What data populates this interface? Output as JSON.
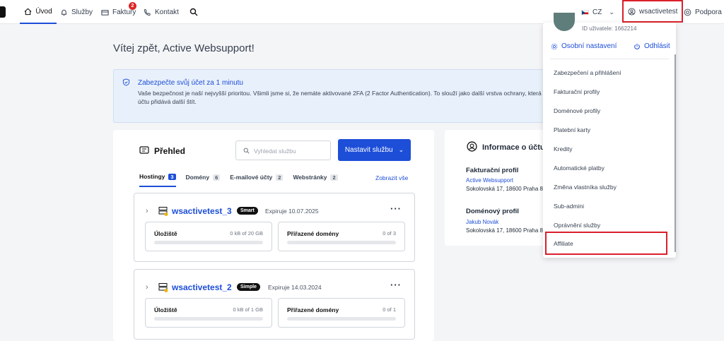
{
  "nav": {
    "home": "Úvod",
    "services": "Služby",
    "invoices": "Faktury",
    "invoices_badge": "2",
    "contact": "Kontakt",
    "lang": "CZ",
    "user": "wsactivetest",
    "support": "Podpora"
  },
  "greeting": "Vítej zpět, Active Websupport!",
  "alert": {
    "title": "Zabezpečte svůj účet za 1 minutu",
    "line1": "Vaše bezpečnost je naší nejvyšší prioritou. Všimli jsme si, že nemáte aktivované 2FA (2 Factor Authentication). To slouží jako další vrstva ochrany, která k vašemu",
    "line2": "účtu přidává další štít."
  },
  "overview": {
    "title": "Přehled",
    "search_placeholder": "Vyhledat službu",
    "setup_button": "Nastavit službu",
    "tabs": [
      {
        "label": "Hostingy",
        "count": "3"
      },
      {
        "label": "Domény",
        "count": "6"
      },
      {
        "label": "E-mailové účty",
        "count": "2"
      },
      {
        "label": "Webstránky",
        "count": "2"
      }
    ],
    "show_all": "Zobrazit vše",
    "services": [
      {
        "name": "wsactivetest_3",
        "plan": "Smart",
        "expiry": "Expiruje 10.07.2025",
        "storage_label": "Úložiště",
        "storage_value": "0 kB of 20 GB",
        "domains_label": "Přiřazené domény",
        "domains_value": "0 of 3"
      },
      {
        "name": "wsactivetest_2",
        "plan": "Simple",
        "expiry": "Expiruje 14.03.2024",
        "storage_label": "Úložiště",
        "storage_value": "0 kB of 1 GB",
        "domains_label": "Přiřazené domény",
        "domains_value": "0 of 1"
      }
    ]
  },
  "info": {
    "title": "Informace o účtu",
    "billing_title": "Fakturační profil",
    "billing_name": "Active Websupport",
    "billing_address": "Sokolovská 17, 18600 Praha 8",
    "domain_title": "Doménový profil",
    "domain_name": "Jakub Novák",
    "domain_address": "Sokolovská 17, 18600 Praha 8"
  },
  "dropdown": {
    "user_id": "ID uživatele: 1662214",
    "settings": "Osobní nastavení",
    "logout": "Odhlásit",
    "items": [
      "Zabezpečení a přihlášení",
      "Fakturační profily",
      "Doménové profily",
      "Platební karty",
      "Kredity",
      "Automatické platby",
      "Změna vlastníka služby",
      "Sub-admini",
      "Oprávnění služby",
      "Affiliate"
    ]
  },
  "colors": {
    "accent": "#1d4ed8",
    "highlight": "#d9202a"
  }
}
